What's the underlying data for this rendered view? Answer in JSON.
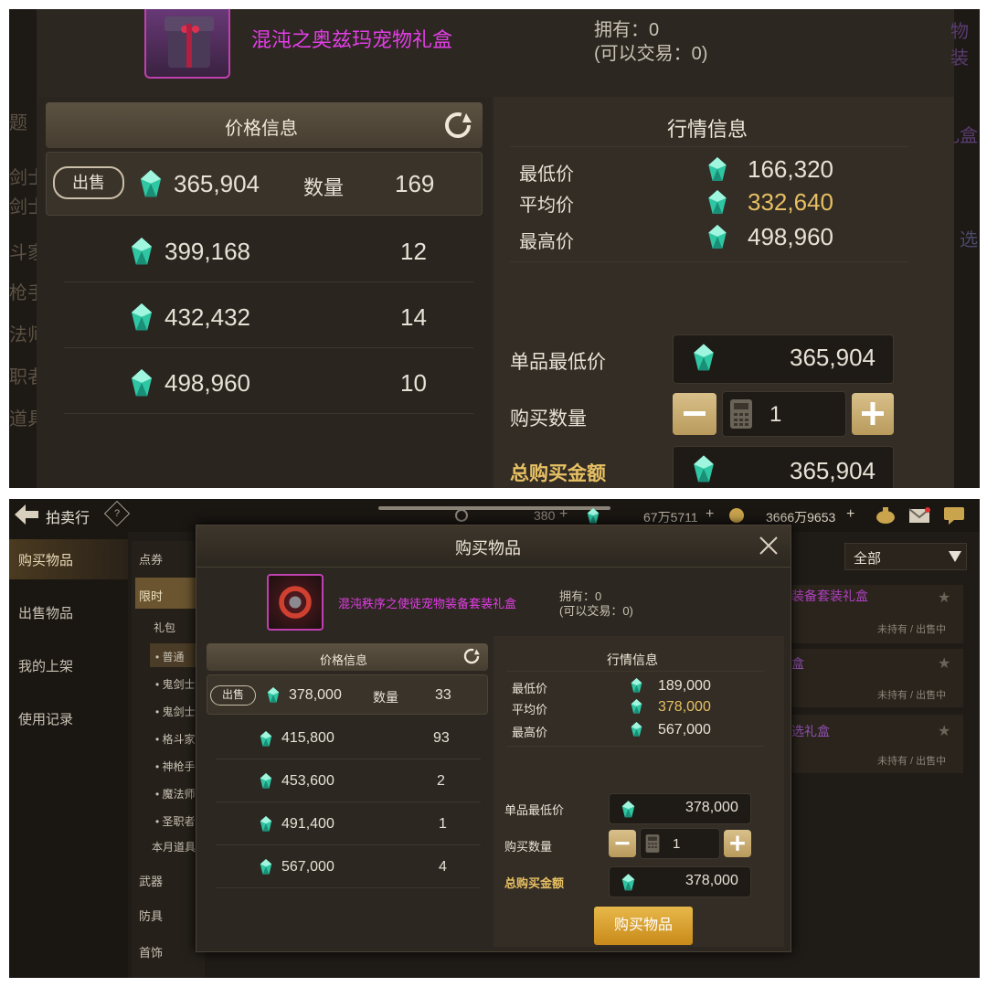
{
  "top": {
    "item_name": "混沌之奥兹玛宠物礼盒",
    "owned": "拥有：0",
    "tradable": "(可以交易：0)",
    "price_header": "价格信息",
    "market_header": "行情信息",
    "sell_label": "出售",
    "quantity_label": "数量",
    "listings": [
      {
        "price": "365,904",
        "qty": "169"
      },
      {
        "price": "399,168",
        "qty": "12"
      },
      {
        "price": "432,432",
        "qty": "14"
      },
      {
        "price": "498,960",
        "qty": "10"
      }
    ],
    "market": {
      "min_label": "最低价",
      "min_value": "166,320",
      "avg_label": "平均价",
      "avg_value": "332,640",
      "max_label": "最高价",
      "max_value": "498,960"
    },
    "unit_min_label": "单品最低价",
    "unit_min_value": "365,904",
    "buy_qty_label": "购买数量",
    "buy_qty_value": "1",
    "total_label": "总购买金额",
    "total_value": "365,904",
    "bg_left_fragments": [
      "题",
      "剑士",
      "剑士",
      "斗家",
      "枪手",
      "法师",
      "职者",
      "道具"
    ],
    "bg_right_fragments": [
      "物装",
      "礼盒",
      "选"
    ]
  },
  "bottom": {
    "back_title": "拍卖行",
    "help_icon_label": "?",
    "currency_1": "380",
    "currency_2": "67万5711",
    "currency_3": "3666万9653",
    "plus": "+",
    "sidebar": [
      "购买物品",
      "出售物品",
      "我的上架",
      "使用记录"
    ],
    "categories": [
      "点券",
      "限时",
      "礼包",
      "• 普通",
      "• 鬼剑士",
      "• 鬼剑士",
      "• 格斗家",
      "• 神枪手",
      "• 魔法师",
      "• 圣职者",
      "本月道具",
      "武器",
      "防具",
      "首饰"
    ],
    "filter_label": "全部",
    "right_list": [
      {
        "name": "装备套装礼盒",
        "status": "未持有 / 出售中"
      },
      {
        "name": "盒",
        "status": "未持有 / 出售中"
      },
      {
        "name": "选礼盒",
        "status": "未持有 / 出售中"
      }
    ],
    "dialog_title": "购买物品",
    "item_name": "混沌秩序之使徒宠物装备套装礼盒",
    "owned": "拥有：0",
    "tradable": "(可以交易：0)",
    "price_header": "价格信息",
    "market_header": "行情信息",
    "sell_label": "出售",
    "quantity_label": "数量",
    "listings": [
      {
        "price": "378,000",
        "qty": "33"
      },
      {
        "price": "415,800",
        "qty": "93"
      },
      {
        "price": "453,600",
        "qty": "2"
      },
      {
        "price": "491,400",
        "qty": "1"
      },
      {
        "price": "567,000",
        "qty": "4"
      }
    ],
    "market": {
      "min_label": "最低价",
      "min_value": "189,000",
      "avg_label": "平均价",
      "avg_value": "378,000",
      "max_label": "最高价",
      "max_value": "567,000"
    },
    "unit_min_label": "单品最低价",
    "unit_min_value": "378,000",
    "buy_qty_label": "购买数量",
    "buy_qty_value": "1",
    "total_label": "总购买金额",
    "total_value": "378,000",
    "buy_button": "购买物品"
  },
  "colors": {
    "accent_gold": "#e7c063",
    "item_name": "#e23ee6",
    "gem": "#3ad6b4"
  },
  "icons": [
    "gem-icon",
    "refresh-icon",
    "calculator-icon",
    "minus-icon",
    "plus-icon",
    "close-icon",
    "back-arrow-icon",
    "help-icon",
    "mail-icon",
    "chat-icon",
    "pot-icon",
    "coin-icon",
    "star-icon",
    "chevron-down-icon"
  ]
}
